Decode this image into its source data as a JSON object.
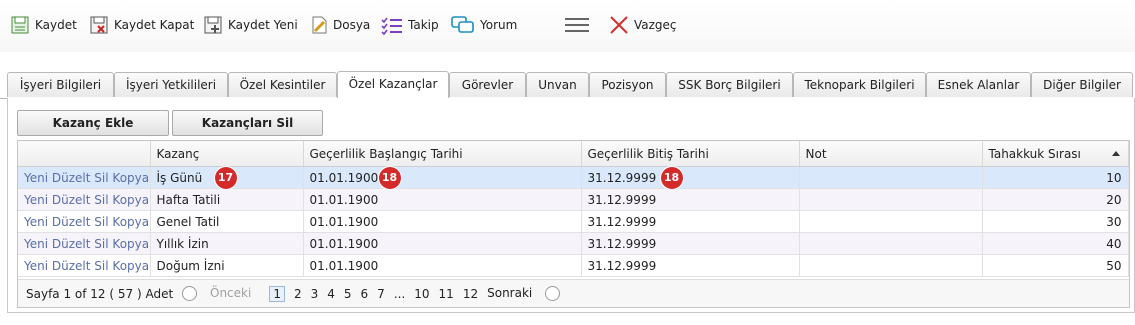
{
  "toolbar": {
    "save": "Kaydet",
    "save_close": "Kaydet Kapat",
    "save_new": "Kaydet Yeni",
    "file": "Dosya",
    "follow": "Takip",
    "comment": "Yorum",
    "cancel": "Vazgeç"
  },
  "tabs": [
    "İşyeri Bilgileri",
    "İşyeri Yetkilileri",
    "Özel Kesintiler",
    "Özel Kazançlar",
    "Görevler",
    "Unvan",
    "Pozisyon",
    "SSK Borç Bilgileri",
    "Teknopark Bilgileri",
    "Esnek Alanlar",
    "Diğer Bilgiler"
  ],
  "buttons": {
    "add": "Kazanç Ekle",
    "delete": "Kazançları Sil"
  },
  "grid": {
    "columns": [
      "Kazanç",
      "Geçerlilik Başlangıç Tarihi",
      "Geçerlilik Bitiş Tarihi",
      "Not",
      "Tahakkuk Sırası"
    ],
    "actions": [
      "Yeni",
      "Düzelt",
      "Sil",
      "Kopya"
    ],
    "rows": [
      {
        "kazanc": "İş Günü",
        "start": "01.01.1900",
        "end": "31.12.9999",
        "note": "",
        "order": "10"
      },
      {
        "kazanc": "Hafta Tatili",
        "start": "01.01.1900",
        "end": "31.12.9999",
        "note": "",
        "order": "20"
      },
      {
        "kazanc": "Genel Tatil",
        "start": "01.01.1900",
        "end": "31.12.9999",
        "note": "",
        "order": "30"
      },
      {
        "kazanc": "Yıllık İzin",
        "start": "01.01.1900",
        "end": "31.12.9999",
        "note": "",
        "order": "40"
      },
      {
        "kazanc": "Doğum İzni",
        "start": "01.01.1900",
        "end": "31.12.9999",
        "note": "",
        "order": "50"
      }
    ],
    "badges": {
      "kazanc": "17",
      "start": "18",
      "end": "18"
    }
  },
  "pager": {
    "summary": "Sayfa 1 of 12 ( 57 ) Adet",
    "prev": "Önceki",
    "next": "Sonraki",
    "pages": [
      "1",
      "2",
      "3",
      "4",
      "5",
      "6",
      "7",
      "...",
      "10",
      "11",
      "12"
    ]
  },
  "colors": {
    "badge": "#d42a2a",
    "selected_row": "#d9e8fb",
    "link": "#5a6fa8"
  }
}
